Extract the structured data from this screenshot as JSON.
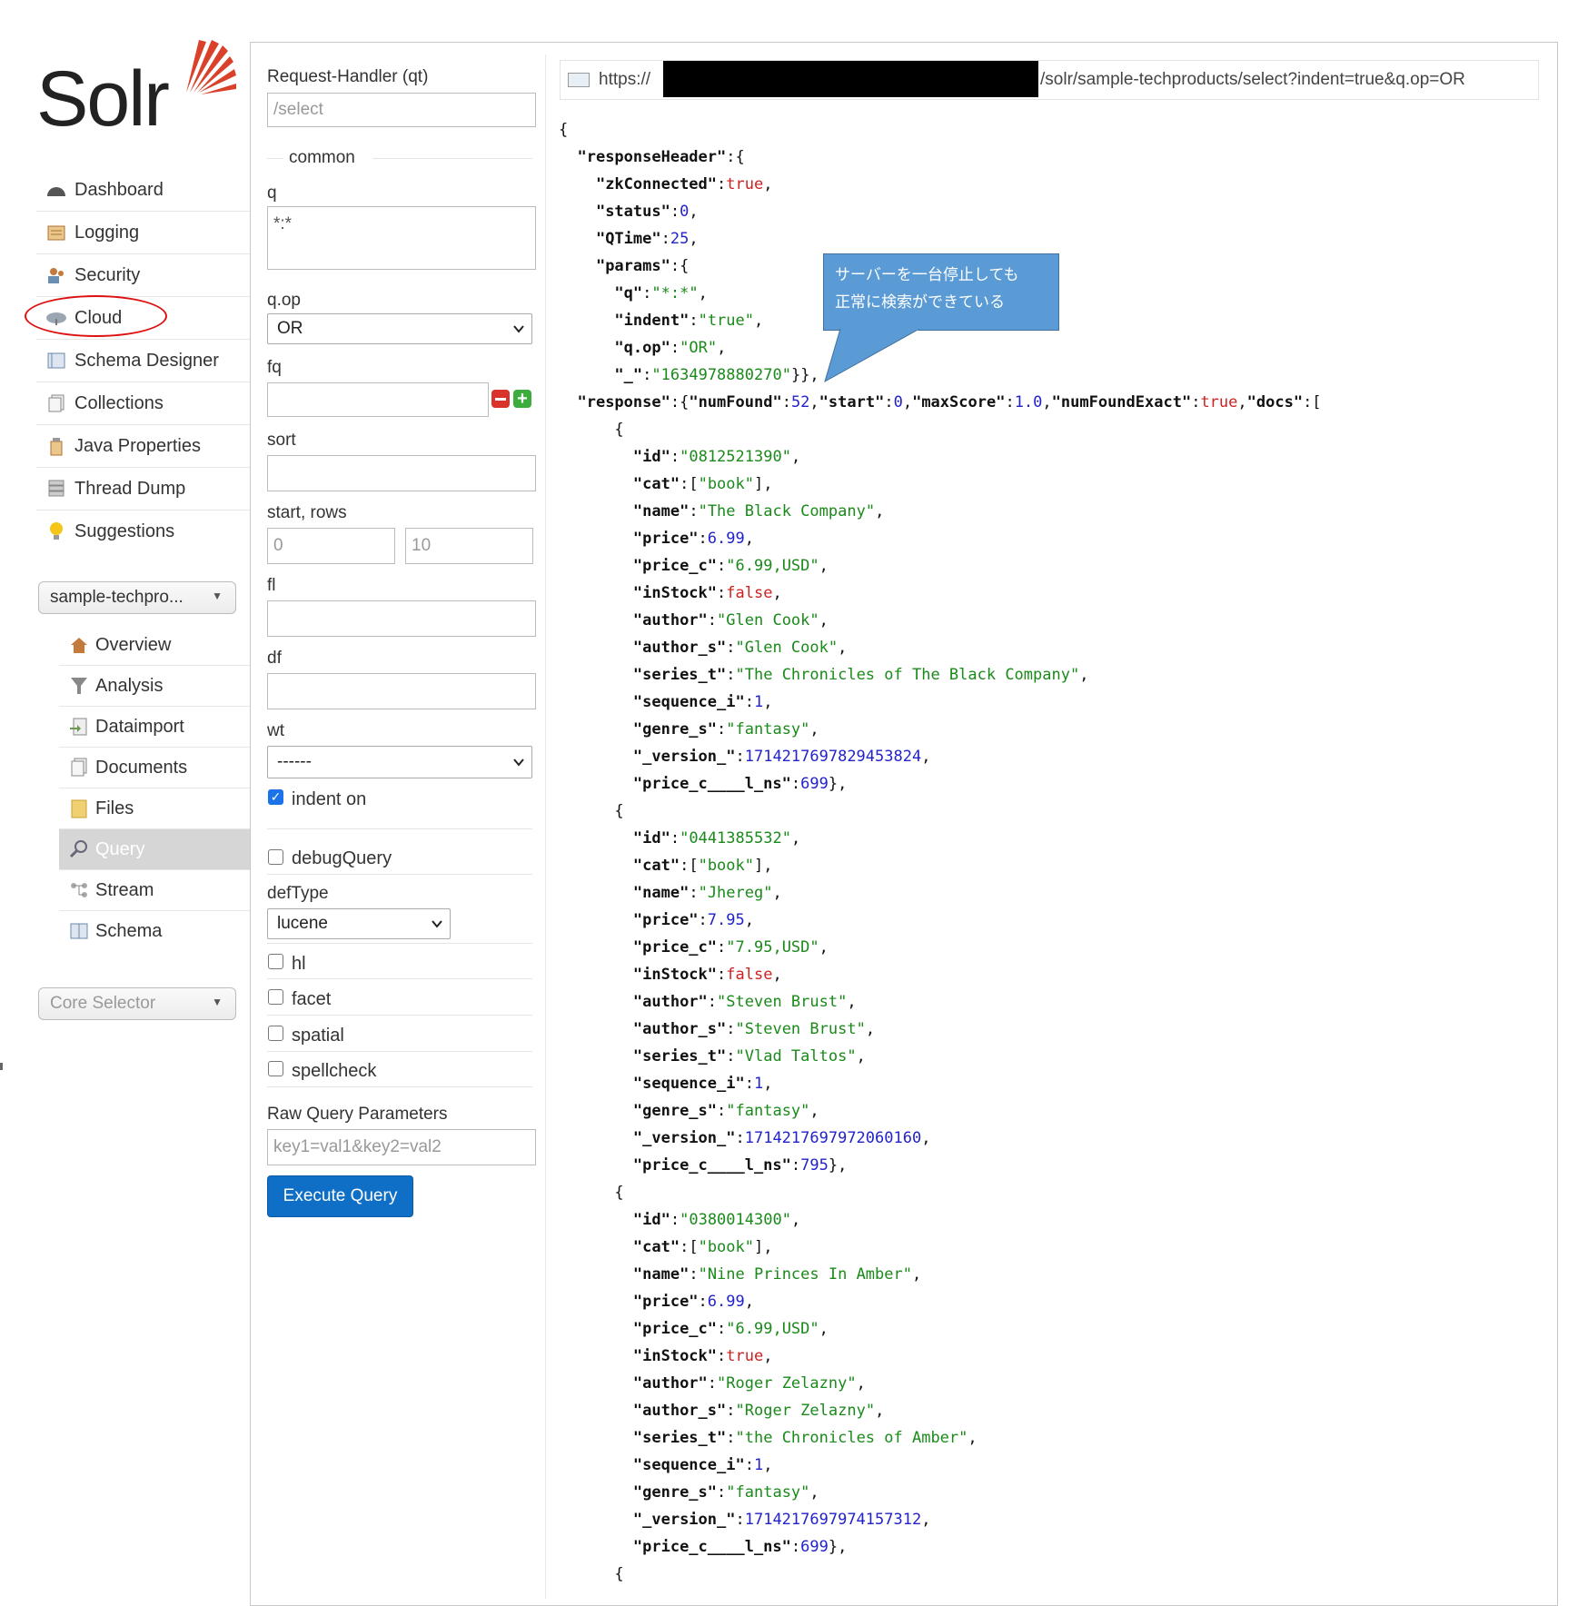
{
  "logo": {
    "text": "Solr"
  },
  "nav": [
    {
      "label": "Dashboard",
      "icon": "dashboard-icon"
    },
    {
      "label": "Logging",
      "icon": "logging-icon"
    },
    {
      "label": "Security",
      "icon": "security-icon"
    },
    {
      "label": "Cloud",
      "icon": "cloud-icon"
    },
    {
      "label": "Schema Designer",
      "icon": "schema-designer-icon"
    },
    {
      "label": "Collections",
      "icon": "collections-icon"
    },
    {
      "label": "Java Properties",
      "icon": "java-properties-icon"
    },
    {
      "label": "Thread Dump",
      "icon": "thread-dump-icon"
    },
    {
      "label": "Suggestions",
      "icon": "suggestions-icon"
    }
  ],
  "collection_selector": {
    "value": "sample-techpro..."
  },
  "core_nav": [
    {
      "label": "Overview",
      "icon": "overview-icon"
    },
    {
      "label": "Analysis",
      "icon": "analysis-icon"
    },
    {
      "label": "Dataimport",
      "icon": "dataimport-icon"
    },
    {
      "label": "Documents",
      "icon": "documents-icon"
    },
    {
      "label": "Files",
      "icon": "files-icon"
    },
    {
      "label": "Query",
      "icon": "query-icon",
      "active": true
    },
    {
      "label": "Stream",
      "icon": "stream-icon"
    },
    {
      "label": "Schema",
      "icon": "schema-icon"
    }
  ],
  "core_selector": {
    "placeholder": "Core Selector"
  },
  "form": {
    "request_handler_label": "Request-Handler (qt)",
    "request_handler_value": "/select",
    "common_legend": "common",
    "q_label": "q",
    "q_value": "*:*",
    "qop_label": "q.op",
    "qop_value": "OR",
    "fq_label": "fq",
    "sort_label": "sort",
    "start_rows_label": "start, rows",
    "start_value": "0",
    "rows_value": "10",
    "fl_label": "fl",
    "df_label": "df",
    "wt_label": "wt",
    "wt_value": "------",
    "indent_label": "indent on",
    "debug_label": "debugQuery",
    "deftype_label": "defType",
    "deftype_value": "lucene",
    "hl_label": "hl",
    "facet_label": "facet",
    "spatial_label": "spatial",
    "spellcheck_label": "spellcheck",
    "raw_label": "Raw Query Parameters",
    "raw_placeholder": "key1=val1&key2=val2",
    "execute_label": "Execute Query"
  },
  "url": {
    "prefix": "https://",
    "suffix": "/solr/sample-techproducts/select?indent=true&q.op=OR"
  },
  "callout": {
    "line1": "サーバーを一台停止しても",
    "line2": "正常に検索ができている"
  },
  "response": {
    "zkConnected": "true",
    "status": "0",
    "QTime": "25",
    "params": {
      "q": "*:*",
      "indent": "true",
      "q_op": "OR",
      "underscore": "1634978880270"
    },
    "numFound": "52",
    "start": "0",
    "maxScore": "1.0",
    "numFoundExact": "true",
    "docs": [
      {
        "id": "0812521390",
        "cat": "book",
        "name": "The Black Company",
        "price": "6.99",
        "price_c": "6.99,USD",
        "inStock": "false",
        "author": "Glen Cook",
        "author_s": "Glen Cook",
        "series_t": "The Chronicles of The Black Company",
        "sequence_i": "1",
        "genre_s": "fantasy",
        "version": "1714217697829453824",
        "price_c_l_ns": "699"
      },
      {
        "id": "0441385532",
        "cat": "book",
        "name": "Jhereg",
        "price": "7.95",
        "price_c": "7.95,USD",
        "inStock": "false",
        "author": "Steven Brust",
        "author_s": "Steven Brust",
        "series_t": "Vlad Taltos",
        "sequence_i": "1",
        "genre_s": "fantasy",
        "version": "1714217697972060160",
        "price_c_l_ns": "795"
      },
      {
        "id": "0380014300",
        "cat": "book",
        "name": "Nine Princes In Amber",
        "price": "6.99",
        "price_c": "6.99,USD",
        "inStock": "true",
        "author": "Roger Zelazny",
        "author_s": "Roger Zelazny",
        "series_t": "the Chronicles of Amber",
        "sequence_i": "1",
        "genre_s": "fantasy",
        "version": "1714217697974157312",
        "price_c_l_ns": "699"
      }
    ]
  }
}
